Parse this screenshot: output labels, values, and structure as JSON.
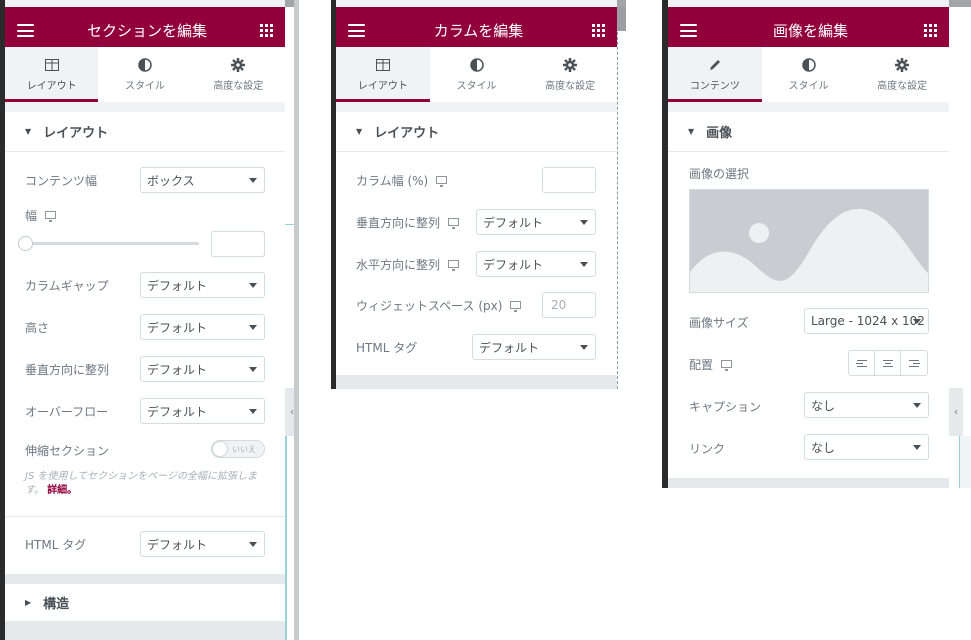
{
  "panels": {
    "section": {
      "title": "セクションを編集",
      "tabs": [
        "レイアウト",
        "スタイル",
        "高度な設定"
      ],
      "group_title": "レイアウト",
      "content_width": {
        "label": "コンテンツ幅",
        "value": "ボックス"
      },
      "width": {
        "label": "幅"
      },
      "column_gap": {
        "label": "カラムギャップ",
        "value": "デフォルト"
      },
      "height": {
        "label": "高さ",
        "value": "デフォルト"
      },
      "vertical_align": {
        "label": "垂直方向に整列",
        "value": "デフォルト"
      },
      "overflow": {
        "label": "オーバーフロー",
        "value": "デフォルト"
      },
      "stretch": {
        "label": "伸縮セクション",
        "toggle": "いいえ",
        "desc": "JS を使用してセクションをページの全幅に拡張します。",
        "link": "詳細。"
      },
      "html_tag": {
        "label": "HTML タグ",
        "value": "デフォルト"
      },
      "structure": "構造"
    },
    "column": {
      "title": "カラムを編集",
      "tabs": [
        "レイアウト",
        "スタイル",
        "高度な設定"
      ],
      "group_title": "レイアウト",
      "column_width": {
        "label": "カラム幅 (%)",
        "value": ""
      },
      "vertical_align": {
        "label": "垂直方向に整列",
        "value": "デフォルト"
      },
      "horizontal_align": {
        "label": "水平方向に整列",
        "value": "デフォルト"
      },
      "widget_space": {
        "label": "ウィジェットスペース (px)",
        "placeholder": "20"
      },
      "html_tag": {
        "label": "HTML タグ",
        "value": "デフォルト"
      }
    },
    "image": {
      "title": "画像を編集",
      "tabs": [
        "コンテンツ",
        "スタイル",
        "高度な設定"
      ],
      "group_title": "画像",
      "choose_image": "画像の選択",
      "image_size": {
        "label": "画像サイズ",
        "value": "Large - 1024 x 102"
      },
      "alignment": {
        "label": "配置"
      },
      "caption": {
        "label": "キャプション",
        "value": "なし"
      },
      "link": {
        "label": "リンク",
        "value": "なし"
      }
    }
  },
  "colors": {
    "accent": "#92003b",
    "panel_bg": "#f1f2f3",
    "border": "#d5dadf"
  }
}
